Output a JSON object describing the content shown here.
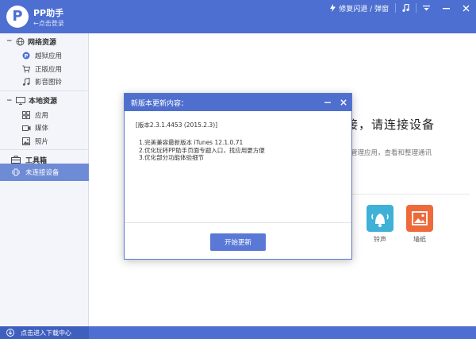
{
  "app": {
    "name": "PP助手",
    "login_link": "←点击登录"
  },
  "topbar": {
    "flash_label": "修复闪退 / 弹窗"
  },
  "sidebar": {
    "network": {
      "title": "网络资源",
      "items": [
        {
          "label": "越狱应用",
          "icon": "pp-app-icon"
        },
        {
          "label": "正版应用",
          "icon": "cart-icon"
        },
        {
          "label": "影音图铃",
          "icon": "music-note-icon"
        }
      ]
    },
    "local": {
      "title": "本地资源",
      "items": [
        {
          "label": "应用",
          "icon": "grid-icon"
        },
        {
          "label": "媒体",
          "icon": "video-icon"
        },
        {
          "label": "照片",
          "icon": "photo-icon"
        }
      ]
    },
    "toolbox": {
      "label": "工具箱"
    },
    "no_device": {
      "label": "未连接设备"
    }
  },
  "main": {
    "heading": "接，请连接设备",
    "subtext": "管理应用，查看和整理通讯",
    "tiles": [
      {
        "label": "铃声",
        "color": "#3fb1d6"
      },
      {
        "label": "墙纸",
        "color": "#ee6a3a"
      }
    ]
  },
  "bottombar": {
    "download_label": "点击进入下载中心"
  },
  "dialog": {
    "title": "新版本更新内容：",
    "version_line": "[版本2.3.1.4453 (2015.2.3)]",
    "notes": [
      "1.完美兼容最新版本 iTunes 12.1.0.71",
      "2.优化玩转PP助手页面专题入口，找应用更方便",
      "3.优化部分功能体验细节"
    ],
    "update_button": "开始更新"
  },
  "colors": {
    "brand": "#4c6fd1",
    "sidebar_active": "#6e8bd6"
  }
}
